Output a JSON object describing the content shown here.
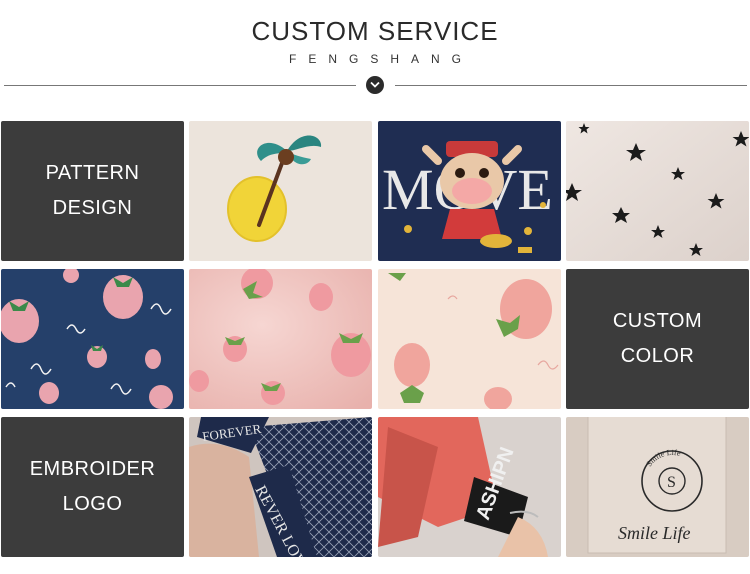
{
  "header": {
    "title": "CUSTOM SERVICE",
    "subtitle": "FENGSHANG"
  },
  "tiles": {
    "pattern": {
      "line1": "PATTERN",
      "line2": "DESIGN"
    },
    "color": {
      "line1": "CUSTOM",
      "line2": "COLOR"
    },
    "logo": {
      "line1": "EMBROIDER",
      "line2": "LOGO"
    }
  },
  "photos": {
    "move_text": "MOVE",
    "forever_text": "FOREVER",
    "forever_love_text": "REVER LOVE",
    "fashion_text": "ASHIPN",
    "smile_life_text": "Smile Life",
    "seal_letter": "S",
    "seal_ring_text": "Smile Life"
  },
  "colors": {
    "dark_tile": "#3c3c3c",
    "navy": "#1f2d52",
    "blush": "#f3c9c3",
    "strawberry": "#e88a96"
  }
}
